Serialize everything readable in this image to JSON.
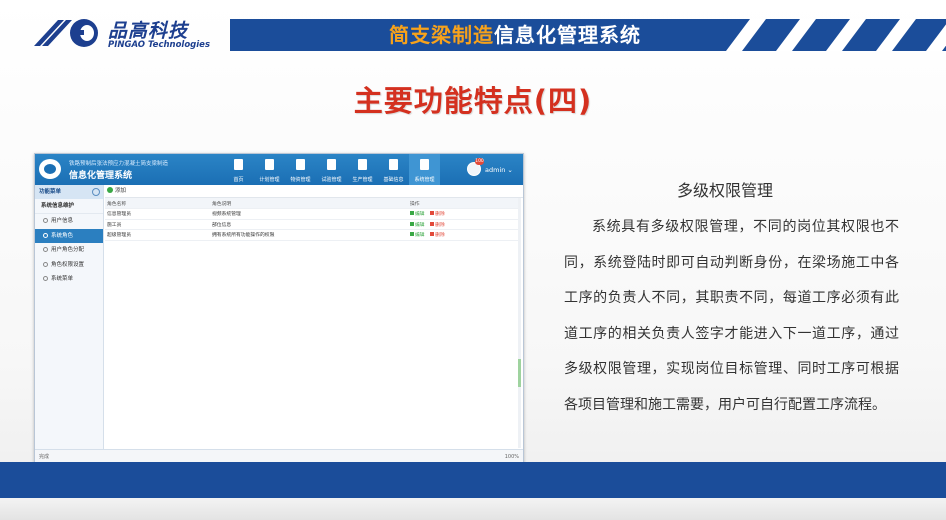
{
  "brand": {
    "name_cn": "品高科技",
    "name_en": "PINGAO Technologies",
    "accent_color": "#1b4d9a"
  },
  "banner": {
    "title_part1": "简支梁制造",
    "title_part2": "信息化管理系统",
    "title_color_1": "#f7a21b",
    "title_color_2": "#ffffff"
  },
  "slide_title": "主要功能特点(四)",
  "app": {
    "subtitle": "铁路预制后张法预应力混凝土简支梁制造",
    "title": "信息化管理系统",
    "nav": [
      {
        "label": "首页",
        "icon": "home-icon"
      },
      {
        "label": "计划管理",
        "icon": "document-icon"
      },
      {
        "label": "物资管理",
        "icon": "box-icon"
      },
      {
        "label": "试验管理",
        "icon": "flask-icon"
      },
      {
        "label": "生产管理",
        "icon": "factory-icon"
      },
      {
        "label": "基础信息",
        "icon": "database-icon"
      },
      {
        "label": "系统管理",
        "icon": "tools-icon"
      }
    ],
    "user": {
      "name": "admin ⌄",
      "badge": "100"
    },
    "sidebar": {
      "header": "功能菜单",
      "group": "系统信息维护",
      "items": [
        "用户信息",
        "系统角色",
        "用户角色分配",
        "角色权限设置",
        "系统菜单"
      ],
      "active_index": 1
    },
    "toolbar": {
      "add_label": "添加"
    },
    "table": {
      "columns": [
        "角色名称",
        "角色说明",
        "操作"
      ],
      "rows": [
        {
          "name": "信息管理员",
          "desc": "视频系统管理"
        },
        {
          "name": "施工员",
          "desc": "部位信息"
        },
        {
          "name": "超级管理员",
          "desc": "拥有系统所有功能操作的权限"
        }
      ],
      "edit_label": "编辑",
      "delete_label": "删除"
    },
    "status": {
      "left": "完成",
      "right": "100%"
    }
  },
  "description": {
    "title": "多级权限管理",
    "body": "系统具有多级权限管理，不同的岗位其权限也不同，系统登陆时即可自动判断身份，在梁场施工中各工序的负责人不同，其职责不同，每道工序必须有此道工序的相关负责人签字才能进入下一道工序，通过多级权限管理，实现岗位目标管理、同时工序可根据各项目管理和施工需要，用户可自行配置工序流程。"
  }
}
